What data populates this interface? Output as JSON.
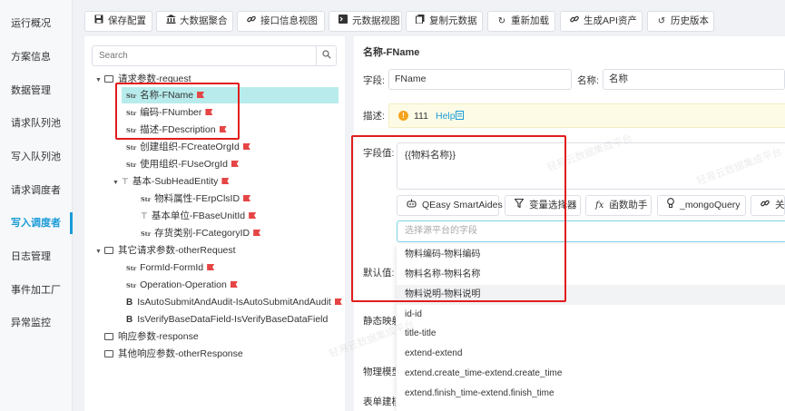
{
  "sidebar": {
    "items": [
      {
        "label": "运行概况"
      },
      {
        "label": "方案信息"
      },
      {
        "label": "数据管理"
      },
      {
        "label": "请求队列池"
      },
      {
        "label": "写入队列池"
      },
      {
        "label": "请求调度者"
      },
      {
        "label": "写入调度者"
      },
      {
        "label": "日志管理"
      },
      {
        "label": "事件加工厂"
      },
      {
        "label": "异常监控"
      }
    ],
    "active_index": 6
  },
  "toolbar": {
    "buttons": [
      {
        "label": "保存配置",
        "icon": "save-icon"
      },
      {
        "label": "大数据聚合",
        "icon": "bank-icon"
      },
      {
        "label": "接口信息视图",
        "icon": "link-icon"
      },
      {
        "label": "元数据视图",
        "icon": "terminal-icon"
      },
      {
        "label": "复制元数据",
        "icon": "copy-icon"
      },
      {
        "label": "重新加载",
        "icon": "refresh-icon"
      },
      {
        "label": "生成API资产",
        "icon": "link-icon"
      },
      {
        "label": "历史版本",
        "icon": "history-icon"
      }
    ]
  },
  "tree": {
    "search_placeholder": "Search",
    "nodes": [
      {
        "label": "请求参数-request",
        "type": "folder",
        "expanded": true
      },
      {
        "label": "名称-FName",
        "type": "str",
        "flag": true,
        "selected": true
      },
      {
        "label": "编码-FNumber",
        "type": "str",
        "flag": true
      },
      {
        "label": "描述-FDescription",
        "type": "str",
        "flag": true
      },
      {
        "label": "创建组织-FCreateOrgId",
        "type": "str",
        "flag": true
      },
      {
        "label": "使用组织-FUseOrgId",
        "type": "str",
        "flag": true
      },
      {
        "label": "基本-SubHeadEntity",
        "type": "tree",
        "flag": true,
        "expanded": true
      },
      {
        "label": "物料属性-FErpClsID",
        "type": "str",
        "flag": true
      },
      {
        "label": "基本单位-FBaseUnitId",
        "type": "tree",
        "flag": true
      },
      {
        "label": "存货类别-FCategoryID",
        "type": "str",
        "flag": true
      },
      {
        "label": "其它请求参数-otherRequest",
        "type": "folder",
        "expanded": true
      },
      {
        "label": "FormId-FormId",
        "type": "str",
        "flag": true
      },
      {
        "label": "Operation-Operation",
        "type": "str",
        "flag": true
      },
      {
        "label": "IsAutoSubmitAndAudit-IsAutoSubmitAndAudit",
        "type": "bool",
        "flag": true
      },
      {
        "label": "IsVerifyBaseDataField-IsVerifyBaseDataField",
        "type": "bool",
        "flag": false
      },
      {
        "label": "响应参数-response",
        "type": "folder",
        "expanded": false
      },
      {
        "label": "其他响应参数-otherResponse",
        "type": "folder",
        "expanded": false
      }
    ]
  },
  "detail": {
    "header": "名称-FName",
    "field_label": "字段:",
    "field_value": "FName",
    "name_label": "名称:",
    "name_value": "名称",
    "desc_label": "描述:",
    "desc_value": "111",
    "help_label": "Help",
    "value_label": "字段值:",
    "value_text": "{{物料名称}}",
    "tools": [
      {
        "label": "QEasy SmartAides",
        "icon": "bot-icon"
      },
      {
        "label": "变量选择器",
        "icon": "filter-icon"
      },
      {
        "label": "函数助手",
        "icon": "function-icon"
      },
      {
        "label": "_mongoQuery",
        "icon": "bulb-icon"
      },
      {
        "label": "关联",
        "icon": "link-icon"
      }
    ],
    "select_placeholder": "选择源平台的字段",
    "default_label": "默认值:",
    "static_label": "静态映射",
    "physical_label": "物理模型",
    "form_label": "表单建模",
    "dropdown_options": [
      "物料编码-物料编码",
      "物料名称-物料名称",
      "物料说明-物料说明",
      "id-id",
      "title-title",
      "extend-extend",
      "extend.create_time-extend.create_time",
      "extend.finish_time-extend.finish_time"
    ]
  },
  "watermark": "轻易云数据集成平台",
  "colors": {
    "accent": "#1a9bd7",
    "selected_row": "#b8ecec",
    "flag": "#e64545",
    "highlight_box": "#e11d1d",
    "desc_bg": "#fdfbe6"
  }
}
